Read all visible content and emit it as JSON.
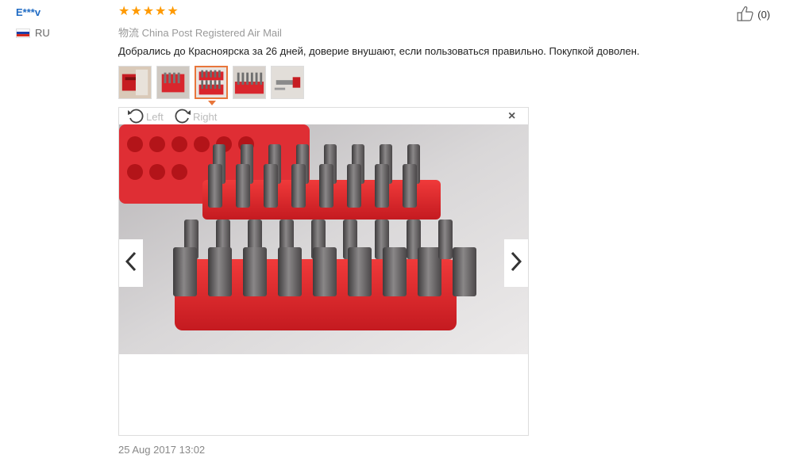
{
  "user": {
    "name": "E***v",
    "country_code": "RU"
  },
  "review": {
    "rating": 5,
    "rating_max": 5,
    "shipping_label": "物流",
    "shipping_method": "China Post Registered Air Mail",
    "text": "Добрались до Красноярска за 26 дней, доверие внушают, если пользоваться правильно. Покупкой доволен.",
    "helpful_count": "(0)",
    "date": "25 Aug 2017 13:02"
  },
  "viewer": {
    "rotate_left_label": "Left",
    "rotate_right_label": "Right",
    "close_symbol": "×",
    "active_thumbnail": 3,
    "thumbnail_count": 5
  },
  "colors": {
    "username": "#1f6bc4",
    "star": "#ff9a00",
    "active_thumb_border": "#e8763b",
    "holder_red": "#e3202a"
  },
  "icons": {
    "helpful": "thumbs-up-icon",
    "rotate_left": "rotate-left-icon",
    "rotate_right": "rotate-right-icon",
    "close": "close-icon",
    "prev": "chevron-left-icon",
    "next": "chevron-right-icon",
    "star": "star-icon",
    "flag": "russia-flag-icon"
  }
}
